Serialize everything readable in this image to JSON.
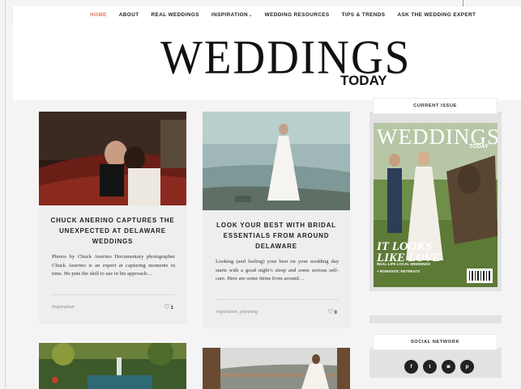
{
  "nav": {
    "items": [
      {
        "label": "HOME",
        "active": true
      },
      {
        "label": "ABOUT",
        "active": false
      },
      {
        "label": "REAL WEDDINGS",
        "active": false
      },
      {
        "label": "INSPIRATION",
        "active": false,
        "dropdown": true
      },
      {
        "label": "WEDDING RESOURCES",
        "active": false
      },
      {
        "label": "TIPS & TRENDS",
        "active": false
      },
      {
        "label": "ASK THE WEDDING EXPERT",
        "active": false
      }
    ],
    "dropdown_glyph": "⌄"
  },
  "logo": {
    "main": "WEDDINGS",
    "sub": "TODAY"
  },
  "posts": [
    {
      "title": "CHUCK ANERINO CAPTURES THE UNEXPECTED AT DELAWARE WEDDINGS",
      "excerpt": "Photos by Chuck Anerino Documentary photographer Chuck Anerino is an expert at capturing moments in time. He puts the skill to use in his approach…",
      "categories": "Inspiration",
      "likes": "1",
      "image": "couple-kissing-in-vintage-car"
    },
    {
      "title": "LOOK YOUR BEST WITH BRIDAL ESSENTIALS FROM AROUND DELAWARE",
      "excerpt": "Looking (and feeling) your best on your wedding day starts with a good night’s sleep and some serious self-care. Here are some items from around…",
      "categories": "inspiration, planning",
      "likes": "0",
      "image": "bride-walking-on-beach"
    },
    {
      "image": "tropical-waterfall-garden"
    },
    {
      "image": "bride-on-terrace"
    }
  ],
  "sidebar": {
    "current_issue_title": "CURRENT ISSUE",
    "magazine": {
      "masthead": "WEDDINGS",
      "sub": "TODAY",
      "headline": "IT LOOKS LIKE LOVE",
      "tagline": "REAL-LIFE LOCAL WEDDINGS",
      "plus": "+ ROMANTIC RETREATS"
    },
    "social_title": "SOCIAL NETWORK",
    "social": [
      {
        "icon": "facebook-icon",
        "glyph": "f"
      },
      {
        "icon": "twitter-icon",
        "glyph": "t"
      },
      {
        "icon": "instagram-icon",
        "glyph": "◙"
      },
      {
        "icon": "pinterest-icon",
        "glyph": "p"
      }
    ]
  },
  "colors": {
    "accent": "#e0745a",
    "card_bg": "#eeeeee",
    "page_bg": "#f4f4f4"
  }
}
